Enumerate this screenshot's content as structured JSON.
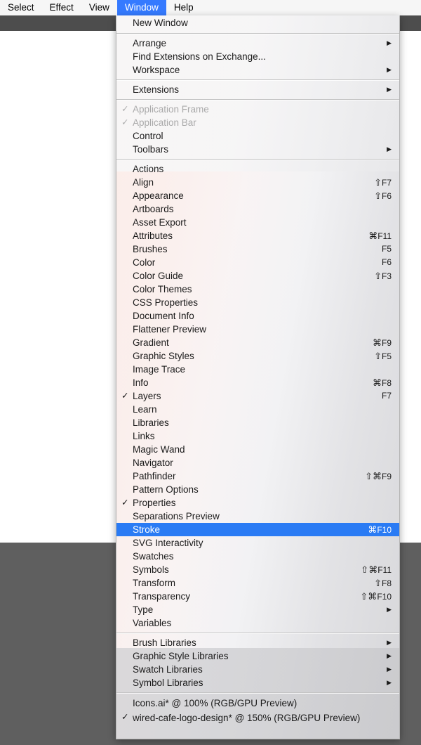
{
  "menubar": {
    "items": [
      {
        "label": "Select",
        "active": false
      },
      {
        "label": "Effect",
        "active": false
      },
      {
        "label": "View",
        "active": false
      },
      {
        "label": "Window",
        "active": true
      },
      {
        "label": "Help",
        "active": false
      }
    ]
  },
  "menu": {
    "title": "Window",
    "highlight_color": "#2a7bf4",
    "groups": [
      {
        "items": [
          {
            "label": "New Window"
          }
        ]
      },
      {
        "items": [
          {
            "label": "Arrange",
            "submenu": true
          },
          {
            "label": "Find Extensions on Exchange..."
          },
          {
            "label": "Workspace",
            "submenu": true
          }
        ]
      },
      {
        "items": [
          {
            "label": "Extensions",
            "submenu": true
          }
        ]
      },
      {
        "items": [
          {
            "label": "Application Frame",
            "checked": true,
            "disabled": true
          },
          {
            "label": "Application Bar",
            "checked": true,
            "disabled": true
          },
          {
            "label": "Control"
          },
          {
            "label": "Toolbars",
            "submenu": true
          }
        ]
      },
      {
        "items": [
          {
            "label": "Actions"
          },
          {
            "label": "Align",
            "shortcut_mod": "⇧",
            "shortcut_key": "F7"
          },
          {
            "label": "Appearance",
            "shortcut_mod": "⇧",
            "shortcut_key": "F6"
          },
          {
            "label": "Artboards"
          },
          {
            "label": "Asset Export"
          },
          {
            "label": "Attributes",
            "shortcut_mod": "⌘",
            "shortcut_key": "F11"
          },
          {
            "label": "Brushes",
            "shortcut_key": "F5"
          },
          {
            "label": "Color",
            "shortcut_key": "F6"
          },
          {
            "label": "Color Guide",
            "shortcut_mod": "⇧",
            "shortcut_key": "F3"
          },
          {
            "label": "Color Themes"
          },
          {
            "label": "CSS Properties"
          },
          {
            "label": "Document Info"
          },
          {
            "label": "Flattener Preview"
          },
          {
            "label": "Gradient",
            "shortcut_mod": "⌘",
            "shortcut_key": "F9"
          },
          {
            "label": "Graphic Styles",
            "shortcut_mod": "⇧",
            "shortcut_key": "F5"
          },
          {
            "label": "Image Trace"
          },
          {
            "label": "Info",
            "shortcut_mod": "⌘",
            "shortcut_key": "F8"
          },
          {
            "label": "Layers",
            "checked": true,
            "shortcut_key": "F7"
          },
          {
            "label": "Learn"
          },
          {
            "label": "Libraries"
          },
          {
            "label": "Links"
          },
          {
            "label": "Magic Wand"
          },
          {
            "label": "Navigator"
          },
          {
            "label": "Pathfinder",
            "shortcut_mod": "⇧⌘",
            "shortcut_key": "F9"
          },
          {
            "label": "Pattern Options"
          },
          {
            "label": "Properties",
            "checked": true
          },
          {
            "label": "Separations Preview"
          },
          {
            "label": "Stroke",
            "selected": true,
            "shortcut_mod": "⌘",
            "shortcut_key": "F10"
          },
          {
            "label": "SVG Interactivity"
          },
          {
            "label": "Swatches"
          },
          {
            "label": "Symbols",
            "shortcut_mod": "⇧⌘",
            "shortcut_key": "F11"
          },
          {
            "label": "Transform",
            "shortcut_mod": "⇧",
            "shortcut_key": "F8"
          },
          {
            "label": "Transparency",
            "shortcut_mod": "⇧⌘",
            "shortcut_key": "F10"
          },
          {
            "label": "Type",
            "submenu": true
          },
          {
            "label": "Variables"
          }
        ]
      },
      {
        "items": [
          {
            "label": "Brush Libraries",
            "submenu": true
          },
          {
            "label": "Graphic Style Libraries",
            "submenu": true
          },
          {
            "label": "Swatch Libraries",
            "submenu": true
          },
          {
            "label": "Symbol Libraries",
            "submenu": true
          }
        ]
      },
      {
        "documents": true,
        "items": [
          {
            "label": "Icons.ai* @ 100% (RGB/GPU Preview)"
          },
          {
            "label": "wired-cafe-logo-design* @ 150% (RGB/GPU Preview)",
            "checked": true
          }
        ]
      }
    ]
  }
}
